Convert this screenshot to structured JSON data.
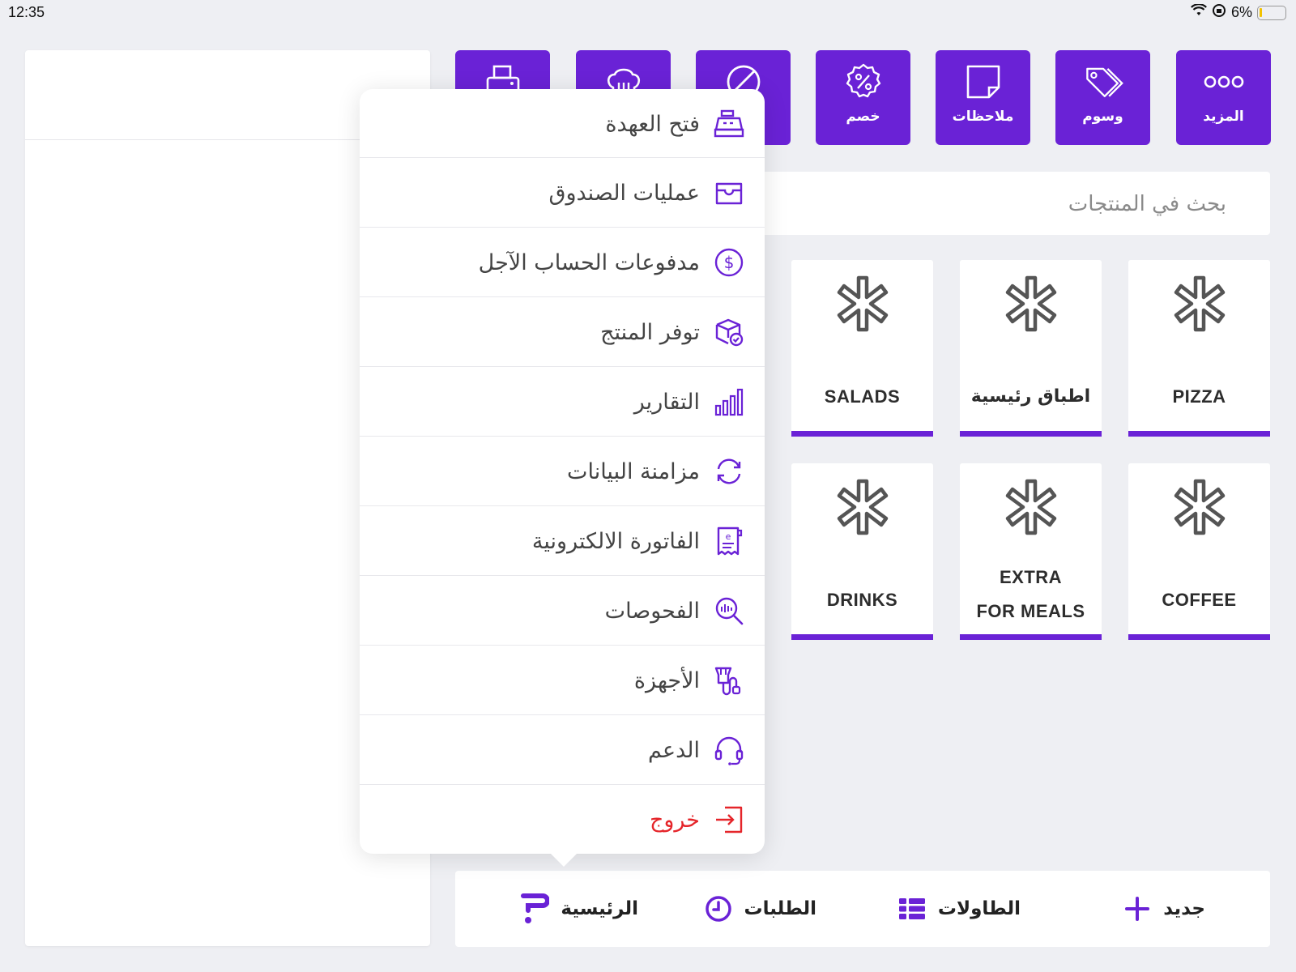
{
  "status_bar": {
    "time": "12:35",
    "battery": "6%"
  },
  "colors": {
    "accent": "#6a22d6",
    "danger": "#e5252a",
    "background": "#eeeff3"
  },
  "toolbar": {
    "buttons": [
      {
        "label": "المزيد",
        "icon": "more-dots-icon"
      },
      {
        "label": "وسوم",
        "icon": "tag-icon"
      },
      {
        "label": "ملاحظات",
        "icon": "note-icon"
      },
      {
        "label": "خصم",
        "icon": "discount-icon"
      },
      {
        "label": "",
        "icon": "void-icon"
      },
      {
        "label": "",
        "icon": "chef-hat-icon"
      },
      {
        "label": "",
        "icon": "printer-icon"
      }
    ]
  },
  "search": {
    "placeholder": "بحث في المنتجات"
  },
  "categories": [
    {
      "name": "PIZZA",
      "icon": "category-asterisk-icon"
    },
    {
      "name": "اطباق رئيسية",
      "icon": "category-asterisk-icon"
    },
    {
      "name": "SALADS",
      "icon": "category-asterisk-icon"
    },
    {
      "name": "COFFEE",
      "icon": "category-asterisk-icon"
    },
    {
      "name_line1": "EXTRA",
      "name_line2": "FOR MEALS",
      "icon": "category-asterisk-icon"
    },
    {
      "name": "DRINKS",
      "icon": "category-asterisk-icon"
    }
  ],
  "menu": {
    "items": [
      {
        "label": "فتح العهدة",
        "icon": "cash-register-icon"
      },
      {
        "label": "عمليات الصندوق",
        "icon": "cash-box-icon"
      },
      {
        "label": "مدفوعات الحساب الآجل",
        "icon": "dollar-circle-icon"
      },
      {
        "label": "توفر المنتج",
        "icon": "product-availability-icon"
      },
      {
        "label": "التقارير",
        "icon": "reports-bar-chart-icon"
      },
      {
        "label": "مزامنة البيانات",
        "icon": "sync-icon"
      },
      {
        "label": "الفاتورة الالكترونية",
        "icon": "e-invoice-icon"
      },
      {
        "label": "الفحوصات",
        "icon": "diagnostics-icon"
      },
      {
        "label": "الأجهزة",
        "icon": "devices-icon"
      },
      {
        "label": "الدعم",
        "icon": "headset-icon"
      },
      {
        "label": "خروج",
        "icon": "logout-icon"
      }
    ]
  },
  "bottom_nav": {
    "items": [
      {
        "label": "جديد",
        "icon": "plus-icon"
      },
      {
        "label": "الطاولات",
        "icon": "tables-grid-icon"
      },
      {
        "label": "الطلبات",
        "icon": "clock-icon"
      },
      {
        "label": "الرئيسية",
        "icon": "home-logo-icon"
      }
    ]
  }
}
